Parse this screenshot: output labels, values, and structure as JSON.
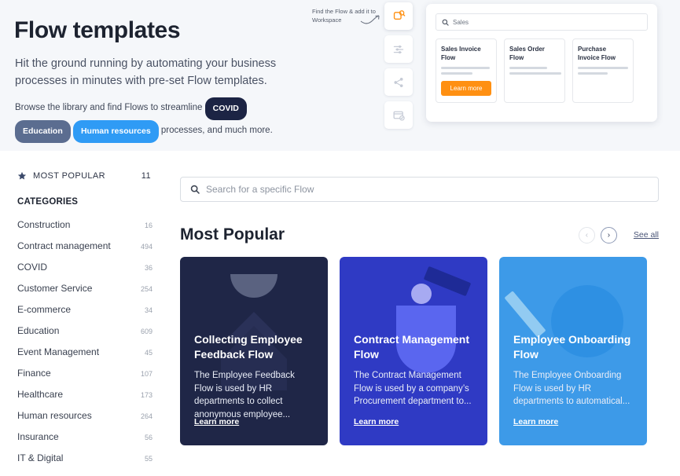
{
  "hero": {
    "title": "Flow templates",
    "subtitle": "Hit the ground running by automating your business processes in minutes with pre-set Flow templates.",
    "browse_prefix": "Browse the library and find Flows to streamline",
    "browse_suffix": "processes, and much more.",
    "chips": [
      {
        "label": "COVID",
        "color": "#1c2444"
      },
      {
        "label": "Education",
        "color": "#5b6d90"
      },
      {
        "label": "Human resources",
        "color": "#2f9bf5"
      }
    ],
    "annotation": "Find the Flow & add it to Workspace",
    "icon_rail": [
      {
        "name": "find-flow-icon",
        "color": "#ff9012"
      },
      {
        "name": "sliders-icon",
        "color": "#c6cbd6"
      },
      {
        "name": "share-icon",
        "color": "#c6cbd6"
      },
      {
        "name": "card-check-icon",
        "color": "#c6cbd6"
      }
    ]
  },
  "preview": {
    "search_value": "Sales",
    "search_icon": "search-icon",
    "cards": [
      {
        "title": "Sales Invoice Flow",
        "lines": [
          62,
          40
        ],
        "button": "Learn more"
      },
      {
        "title": "Sales Order Flow",
        "lines": [
          48,
          66
        ],
        "button": null
      },
      {
        "title": "Purchase Invoice Flow",
        "lines": [
          64,
          38
        ],
        "button": null
      }
    ],
    "button_color": "#ff9012"
  },
  "sidebar": {
    "most_popular": {
      "label": "MOST POPULAR",
      "count": "11",
      "icon": "star-icon"
    },
    "categories_heading": "CATEGORIES",
    "items": [
      {
        "label": "Construction",
        "count": "16"
      },
      {
        "label": "Contract management",
        "count": "494"
      },
      {
        "label": "COVID",
        "count": "36"
      },
      {
        "label": "Customer Service",
        "count": "254"
      },
      {
        "label": "E-commerce",
        "count": "34"
      },
      {
        "label": "Education",
        "count": "609"
      },
      {
        "label": "Event Management",
        "count": "45"
      },
      {
        "label": "Finance",
        "count": "107"
      },
      {
        "label": "Healthcare",
        "count": "173"
      },
      {
        "label": "Human resources",
        "count": "264"
      },
      {
        "label": "Insurance",
        "count": "56"
      },
      {
        "label": "IT & Digital",
        "count": "55"
      }
    ]
  },
  "content": {
    "search_placeholder": "Search for a specific Flow",
    "search_value": "",
    "section_title": "Most Popular",
    "prev_label": "‹",
    "next_label": "›",
    "see_all": "See all",
    "cards": [
      {
        "title": "Collecting Employee Feedback Flow",
        "description": "The Employee Feedback Flow is used by HR departments to collect anonymous employee...",
        "link": "Learn more",
        "bg": "#1f2647"
      },
      {
        "title": "Contract Management Flow",
        "description": "The Contract Management Flow is used by a company’s Procurement department to...",
        "link": "Learn more",
        "bg": "#2f3ac4"
      },
      {
        "title": "Employee Onboarding Flow",
        "description": "The Employee Onboarding Flow is used by HR departments to automatical...",
        "link": "Learn more",
        "bg": "#3d9ae8"
      }
    ]
  }
}
